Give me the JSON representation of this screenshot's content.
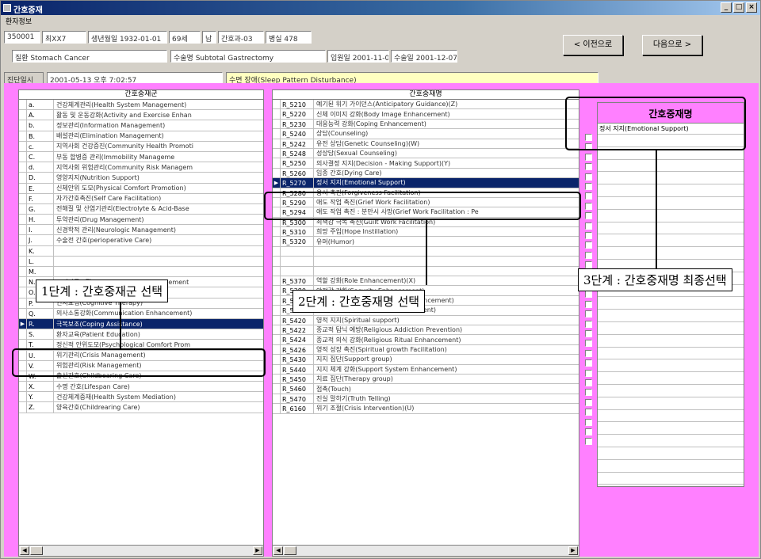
{
  "window": {
    "title": "간호중재",
    "min": "_",
    "max": "□",
    "close": "×"
  },
  "patient": {
    "label": "환자정보",
    "fields": [
      "350001",
      "최XX7",
      "생년월일 1932-01-01",
      "69세",
      "남",
      "간호과-03",
      "병실 478"
    ],
    "row2": [
      "질환 Stomach Cancer",
      "수술명 Subtotal Gastrectomy",
      "입원일 2001-11-01",
      "수술일 2001-12-07"
    ]
  },
  "nav": {
    "prev": "< 이전으로",
    "next": "다음으로 >"
  },
  "diagnosis": {
    "label": "진단일시",
    "datetime": "2001-05-13 오후 7:02:57",
    "text": "수면 장애(Sleep Pattern Disturbance)"
  },
  "panel1": {
    "header": "간호중재군",
    "rows": [
      {
        "code": "a.",
        "name": "건강체계관리(Health System Management)"
      },
      {
        "code": "A.",
        "name": "활동 및 운동강화(Activity and Exercise Enhan"
      },
      {
        "code": "b.",
        "name": "정보관리(Information Management)"
      },
      {
        "code": "B.",
        "name": "배설관리(Elimination Management)"
      },
      {
        "code": "c.",
        "name": "지역사회 건강증진(Community Health Promoti"
      },
      {
        "code": "C.",
        "name": "부동 합병증 관리(Immobility Manageme"
      },
      {
        "code": "d.",
        "name": "지역사회 위험관리(Community Risk Managem"
      },
      {
        "code": "D.",
        "name": "영양지지(Nutrition Support)"
      },
      {
        "code": "E.",
        "name": "신체안위 도모(Physical Comfort Promotion)"
      },
      {
        "code": "F.",
        "name": "자가간호촉진(Self Care Facilitation)"
      },
      {
        "code": "G.",
        "name": "전해질 및 산염기관리(Electrolyte & Acid-Base"
      },
      {
        "code": "H.",
        "name": "투약관리(Drug Management)"
      },
      {
        "code": "I.",
        "name": "신경학적 관리(Neurologic Management)"
      },
      {
        "code": "J.",
        "name": "수술전 간호(perioperative Care)"
      },
      {
        "code": "K.",
        "name": ""
      },
      {
        "code": "L.",
        "name": ""
      },
      {
        "code": "M.",
        "name": ""
      },
      {
        "code": "N.",
        "name": "조직관류조절(Tissue Perfusion Management"
      },
      {
        "code": "O.",
        "name": "행동요법(Behavior therapy)"
      },
      {
        "code": "P.",
        "name": "인지요법(Cognitive Therapy)"
      },
      {
        "code": "Q.",
        "name": "의사소통강화(Communication Enhancement)"
      },
      {
        "code": "R.",
        "name": "극복보조(Coping Assistance)",
        "selected": true
      },
      {
        "code": "S.",
        "name": "환자교육(Patient Education)"
      },
      {
        "code": "T.",
        "name": "정신적 안위도모(Psychological Comfort Prom"
      },
      {
        "code": "U.",
        "name": "위기관리(Crisis Management)"
      },
      {
        "code": "V.",
        "name": "위험관리(Risk Management)"
      },
      {
        "code": "W.",
        "name": "출산간호(Childbearing Care)"
      },
      {
        "code": "X.",
        "name": "수명 간호(Lifespan Care)"
      },
      {
        "code": "Y.",
        "name": "건강체계중재(Health System Mediation)"
      },
      {
        "code": "Z.",
        "name": "양육간호(Childrearing Care)"
      }
    ]
  },
  "panel2": {
    "header": "간호중재명",
    "rows": [
      {
        "code": "R_5210",
        "name": "예기된 위기 가이던스(Anticipatory Guidance)(Z)"
      },
      {
        "code": "R_5220",
        "name": "신체 이미지 강화(Body Image Enhancement)"
      },
      {
        "code": "R_5230",
        "name": "대응능력 강화(Coping Enhancement)"
      },
      {
        "code": "R_5240",
        "name": "상담(Counseling)"
      },
      {
        "code": "R_5242",
        "name": "유전 상담(Genetic Counseling)(W)"
      },
      {
        "code": "R_5248",
        "name": "성상담(Sexual Counseling)"
      },
      {
        "code": "R_5250",
        "name": "의사결정 지지(Decision - Making Support)(Y)"
      },
      {
        "code": "R_5260",
        "name": "임종 간호(Dying Care)"
      },
      {
        "code": "R_5270",
        "name": "정서 지지(Emotional Support)",
        "selected": true
      },
      {
        "code": "R_5280",
        "name": "용서 촉진(Forgiveness Facilitation)"
      },
      {
        "code": "R_5290",
        "name": "애도 작업 촉진(Grief Work Facilitation)"
      },
      {
        "code": "R_5294",
        "name": "애도 작업 촉진 : 분만시 사망(Grief Work Facilitation : Pe"
      },
      {
        "code": "R_5300",
        "name": "죄책감 극복 촉진(Guilt Work Facilitation)"
      },
      {
        "code": "R_5310",
        "name": "희망 주입(Hope Instillation)"
      },
      {
        "code": "R_5320",
        "name": "유머(Humor)"
      },
      {
        "code": "",
        "name": ""
      },
      {
        "code": "",
        "name": ""
      },
      {
        "code": "",
        "name": ""
      },
      {
        "code": "R_5370",
        "name": "역할 강화(Role Enhancement)(X)"
      },
      {
        "code": "R_5380",
        "name": "안전감 강화(Security Enhancement)"
      },
      {
        "code": "R_5390",
        "name": "자기 인식 강화(Self-Awareness Enhancement)"
      },
      {
        "code": "R_5400",
        "name": "자존감 강화(Self-Esteem Enhancement)"
      },
      {
        "code": "R_5420",
        "name": "영적 지지(Spiritual support)"
      },
      {
        "code": "R_5422",
        "name": "종교적 탐닉 예방(Religious Addiction Prevention)"
      },
      {
        "code": "R_5424",
        "name": "종교적 의식 강화(Religious Ritual Enhancement)"
      },
      {
        "code": "R_5426",
        "name": "영적 성장 촉진(Spiritual growth Facilitation)"
      },
      {
        "code": "R_5430",
        "name": "지지 집단(Support group)"
      },
      {
        "code": "R_5440",
        "name": "지지 체계 강화(Support System Enhancement)"
      },
      {
        "code": "R_5450",
        "name": "치료 집단(Therapy group)"
      },
      {
        "code": "R_5460",
        "name": "접촉(Touch)"
      },
      {
        "code": "R_5470",
        "name": "진실 말하기(Truth Telling)"
      },
      {
        "code": "R_6160",
        "name": "위기 조절(Crisis Intervention)(U)"
      }
    ]
  },
  "panel3": {
    "header": "간호중재명",
    "selected": "정서 지지(Emotional Support)"
  },
  "annotations": {
    "step1": "1단계 : 간호중재군 선택",
    "step2": "2단계 : 간호중재명 선택",
    "step3": "3단계 : 간호중재명 최종선택"
  }
}
